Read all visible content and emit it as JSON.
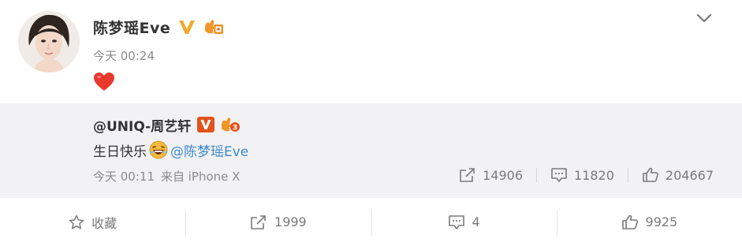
{
  "post": {
    "author_name": "陈梦瑶Eve",
    "time": "今天 00:24",
    "content_emoji": "heart",
    "verified_badge_color": "#f2a92c",
    "fan_badge_color": "#f29527"
  },
  "repost": {
    "user": "@UNIQ-周艺轩",
    "verified_badge_color": "#e3531d",
    "text_before": "生日快乐",
    "text_emoji": "laughing-face",
    "mention": "@陈梦瑶Eve",
    "time": "今天 00:11",
    "source": "来自 iPhone X",
    "forward_count": "14906",
    "comment_count": "11820",
    "like_count": "204667"
  },
  "actions": {
    "favorite_label": "收藏",
    "forward_count": "1999",
    "comment_count": "4",
    "like_count": "9925"
  },
  "colors": {
    "mention": "#3c8ac9",
    "repost_background": "#f2f2f5",
    "heart": "#e8392d"
  }
}
